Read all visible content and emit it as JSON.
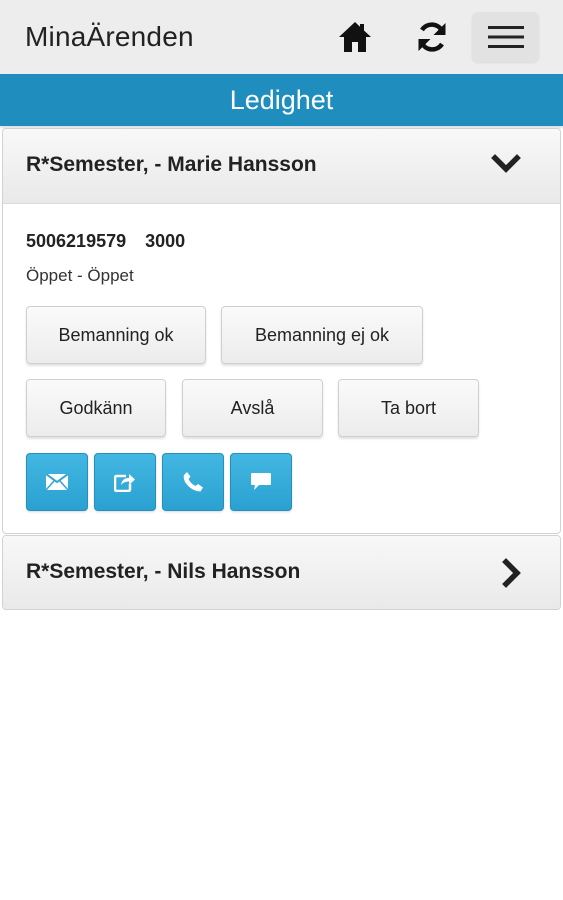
{
  "header": {
    "app_title": "MinaÄrenden",
    "icons": [
      "home-icon",
      "refresh-icon",
      "menu-icon"
    ]
  },
  "section": {
    "title": "Ledighet"
  },
  "items": [
    {
      "title": "R*Semester, - Marie Hansson",
      "expanded": true,
      "order_number": "5006219579",
      "code": "3000",
      "status": "Öppet - Öppet",
      "buttons": {
        "staffing_ok": "Bemanning ok",
        "staffing_not_ok": "Bemanning ej ok",
        "approve": "Godkänn",
        "reject": "Avslå",
        "delete": "Ta bort"
      },
      "action_icons": [
        "mail-icon",
        "share-icon",
        "phone-icon",
        "chat-icon"
      ]
    },
    {
      "title": "R*Semester, - Nils Hansson",
      "expanded": false
    }
  ],
  "colors": {
    "accent": "#1f8ebf",
    "action_button": "#35add9"
  }
}
